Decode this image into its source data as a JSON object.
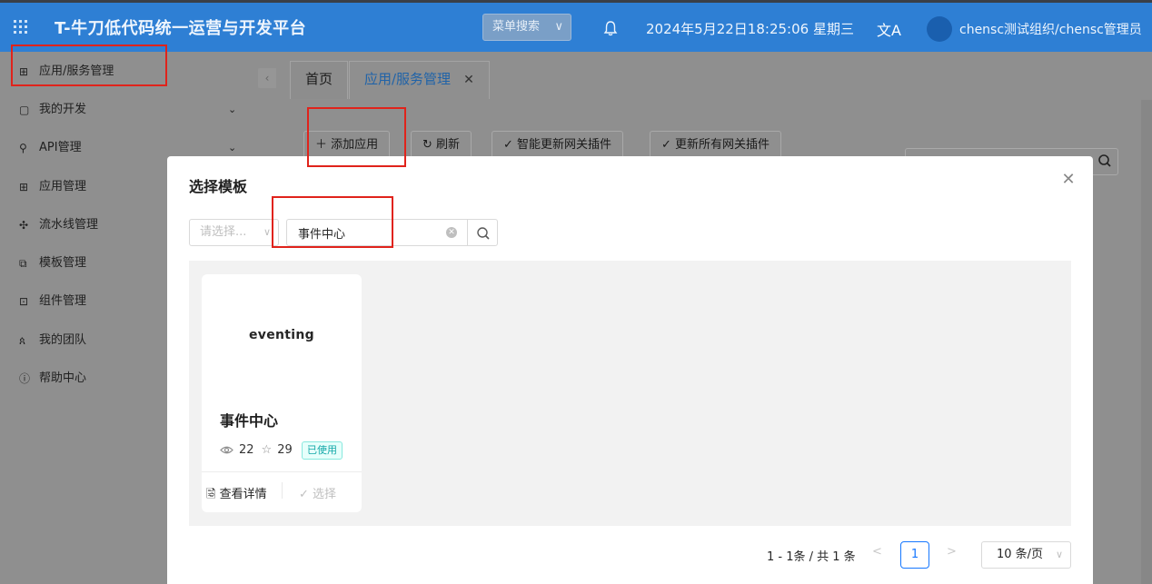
{
  "header": {
    "title": "T-牛刀低代码统一运营与开发平台",
    "menu_search_placeholder": "菜单搜索",
    "datetime": "2024年5月22日18:25:06 星期三",
    "user": "chensc测试组织/chensc管理员",
    "lang_glyph": "文A"
  },
  "sidebar": {
    "items": [
      {
        "label": "应用/服务管理",
        "icon": "app-grid-icon",
        "active": true
      },
      {
        "label": "我的开发",
        "icon": "dev-icon",
        "expandable": true
      },
      {
        "label": "API管理",
        "icon": "api-icon",
        "expandable": true
      },
      {
        "label": "应用管理",
        "icon": "apps-icon"
      },
      {
        "label": "流水线管理",
        "icon": "pipeline-icon"
      },
      {
        "label": "模板管理",
        "icon": "template-icon"
      },
      {
        "label": "组件管理",
        "icon": "component-icon"
      },
      {
        "label": "我的团队",
        "icon": "team-icon"
      },
      {
        "label": "帮助中心",
        "icon": "help-icon"
      }
    ]
  },
  "tabs": [
    {
      "label": "首页"
    },
    {
      "label": "应用/服务管理",
      "active": true,
      "closable": true
    }
  ],
  "toolbar": {
    "add": "添加应用",
    "refresh": "刷新",
    "smart_update": "智能更新网关插件",
    "update_all": "更新所有网关插件"
  },
  "modal": {
    "title": "选择模板",
    "select_placeholder": "请选择...",
    "search_value": "事件中心",
    "cards": [
      {
        "cover_text": "eventing",
        "name": "事件中心",
        "views": "22",
        "stars": "29",
        "badge": "已使用",
        "detail_label": "查看详情",
        "select_label": "选择"
      }
    ],
    "pagination": {
      "total": "1 - 1条 / 共 1 条",
      "current_page": "1",
      "page_size": "10 条/页"
    }
  },
  "colors": {
    "header": "#2e7fd4",
    "accent": "#1677ff",
    "badge_text": "#13a8a8",
    "annotation": "#e0231b"
  }
}
